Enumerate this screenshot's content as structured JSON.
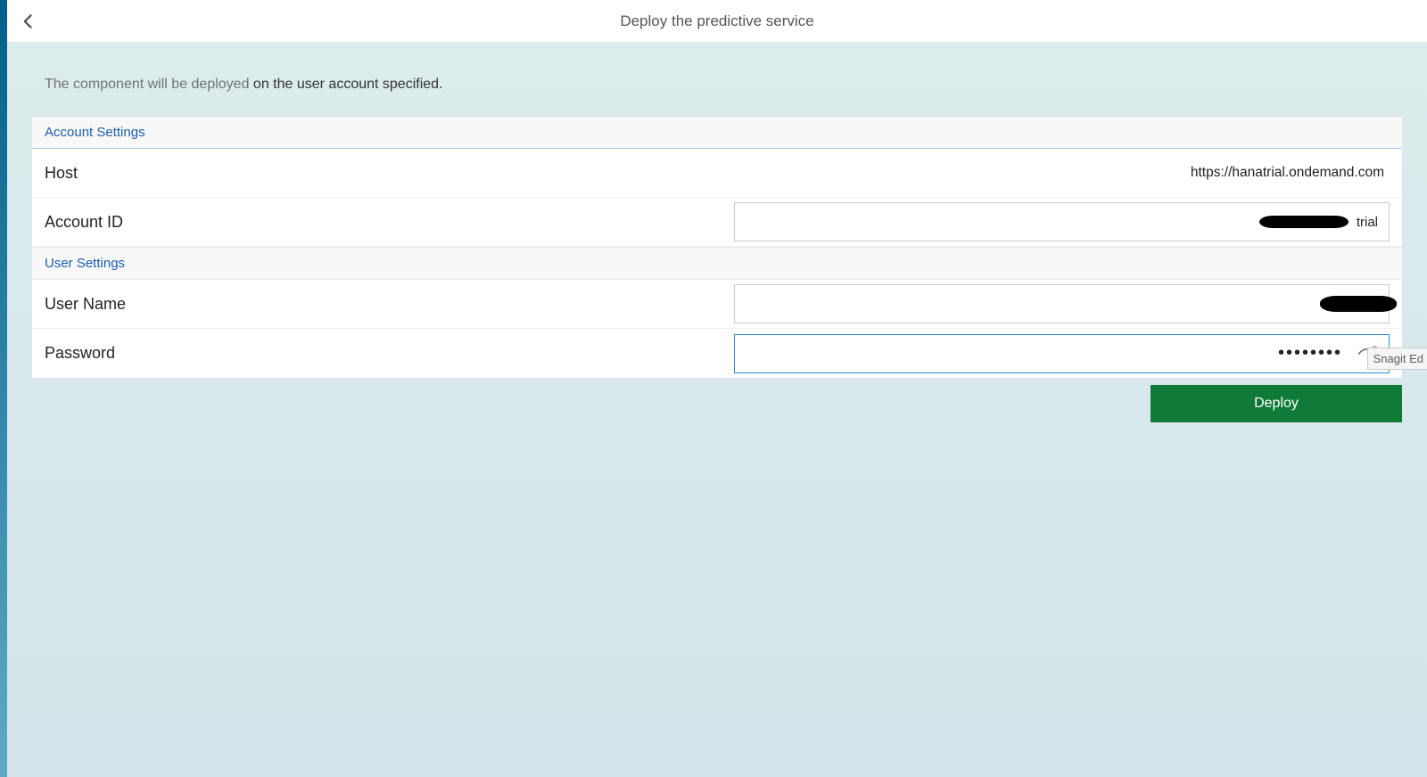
{
  "header": {
    "title": "Deploy the predictive service"
  },
  "instructions": {
    "prefix": "The component will be deployed ",
    "emph": "on the user account specified."
  },
  "sections": {
    "account": {
      "title": "Account Settings",
      "host_label": "Host",
      "host_value": "https://hanatrial.ondemand.com",
      "accountid_label": "Account ID",
      "accountid_value": "trial"
    },
    "user": {
      "title": "User Settings",
      "username_label": "User Name",
      "username_value": "",
      "password_label": "Password",
      "password_value": "••••••••"
    }
  },
  "actions": {
    "deploy_label": "Deploy"
  },
  "overlay": {
    "snagit": "Snagit Ed"
  }
}
